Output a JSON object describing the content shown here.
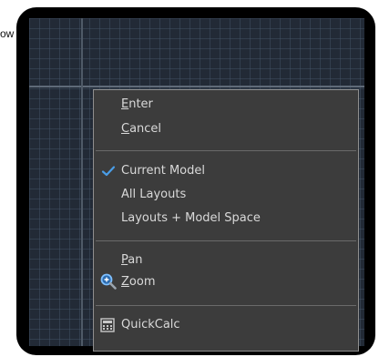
{
  "edge_text": "ow",
  "menu": {
    "enter_label": "Enter",
    "enter_accel": "E",
    "enter_rest": "nter",
    "cancel_accel": "C",
    "cancel_rest": "ancel",
    "current_model": "Current Model",
    "all_layouts": "All Layouts",
    "layouts_model_space": "Layouts + Model Space",
    "pan_accel": "P",
    "pan_rest": "an",
    "zoom_accel": "Z",
    "zoom_rest": "oom",
    "quickcalc": "QuickCalc"
  },
  "icons": {
    "current_model": "checkmark-icon",
    "zoom": "zoom-icon",
    "quickcalc": "calculator-icon"
  },
  "colors": {
    "menu_bg": "#3c3c3c",
    "menu_text": "#d9d9d9",
    "canvas_bg": "#222a36",
    "accent": "#4a9ee8"
  }
}
